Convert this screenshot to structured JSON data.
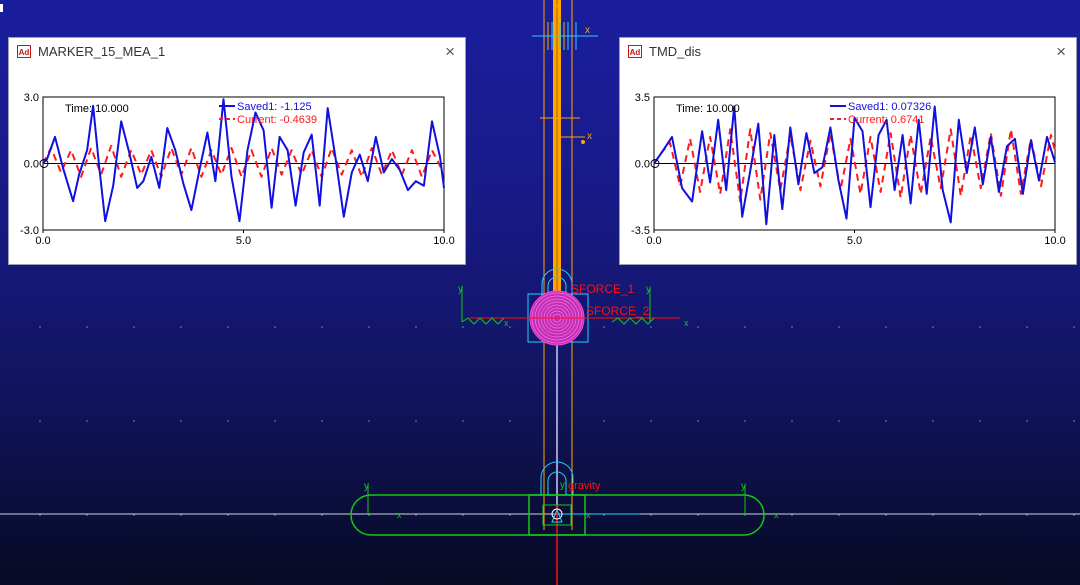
{
  "colors": {
    "saved": "#1010e0",
    "current": "#ff1a1a",
    "axis": "#000000",
    "green": "#14c814",
    "orange": "#ffa500",
    "magenta": "#e020c0",
    "red": "#ff1010",
    "cyan": "#20d0ff",
    "white": "#ffffff"
  },
  "plots": [
    {
      "title": "MARKER_15_MEA_1",
      "icon": "Ad",
      "close": "×",
      "time_label": "Time:  10.000",
      "legend": [
        {
          "label": "Saved1:  -1.125",
          "series": "saved"
        },
        {
          "label": "Current:  -0.4639",
          "series": "current"
        }
      ],
      "chart_data": {
        "type": "line",
        "xlim": [
          0,
          10
        ],
        "ylim": [
          -3,
          3
        ],
        "x_ticks": [
          "0.0",
          "5.0",
          "10.0"
        ],
        "y_ticks": [
          "3.0",
          "0.0",
          "-3.0"
        ],
        "series": [
          {
            "name": "Saved1",
            "style": "solid",
            "x": [
              0,
              0.1,
              0.3,
              0.5,
              0.75,
              0.9,
              1.1,
              1.25,
              1.4,
              1.55,
              1.75,
              1.95,
              2.15,
              2.35,
              2.5,
              2.7,
              2.9,
              3.1,
              3.3,
              3.5,
              3.7,
              3.9,
              4.1,
              4.3,
              4.5,
              4.7,
              4.9,
              5.1,
              5.3,
              5.5,
              5.7,
              5.9,
              6.1,
              6.3,
              6.5,
              6.7,
              6.9,
              7.1,
              7.3,
              7.5,
              7.7,
              7.9,
              8.1,
              8.3,
              8.5,
              8.7,
              8.9,
              9.1,
              9.3,
              9.5,
              9.7,
              9.9,
              10
            ],
            "y": [
              0,
              0.2,
              1.2,
              -0.2,
              -1.7,
              -0.5,
              0.6,
              2.6,
              -0.1,
              -2.6,
              -1,
              1.9,
              0.5,
              -1.1,
              -0.8,
              0.3,
              -1.1,
              1.6,
              0.6,
              -0.9,
              -2.1,
              -0.3,
              1.4,
              -0.8,
              2.9,
              -0.6,
              -2.6,
              0.6,
              2.3,
              1.5,
              -2.0,
              1.2,
              0.6,
              -1.9,
              0.5,
              1.3,
              -1.9,
              2.5,
              0.2,
              -2.4,
              -0.4,
              0.4,
              -0.8,
              1.2,
              -0.4,
              0.2,
              -0.3,
              -1.2,
              -0.8,
              -1.0,
              1.9,
              0.3,
              -1.1
            ]
          },
          {
            "name": "Current",
            "style": "dashed",
            "x": [
              0,
              0.2,
              0.45,
              0.7,
              0.95,
              1.2,
              1.45,
              1.7,
              1.95,
              2.2,
              2.45,
              2.7,
              2.95,
              3.2,
              3.45,
              3.7,
              3.95,
              4.2,
              4.45,
              4.7,
              4.95,
              5.2,
              5.45,
              5.7,
              5.95,
              6.2,
              6.45,
              6.7,
              6.95,
              7.2,
              7.45,
              7.7,
              7.95,
              8.2,
              8.45,
              8.7,
              8.95,
              9.2,
              9.45,
              9.7,
              10
            ],
            "y": [
              0,
              0.7,
              -0.4,
              0.6,
              -0.6,
              0.7,
              -0.5,
              0.8,
              -0.6,
              0.6,
              -0.5,
              0.6,
              -0.6,
              0.7,
              -0.5,
              0.7,
              -0.6,
              0.6,
              -0.5,
              0.7,
              -0.6,
              0.6,
              -0.6,
              0.7,
              -0.5,
              0.6,
              -0.5,
              0.6,
              -0.6,
              0.7,
              -0.5,
              0.6,
              -0.6,
              0.7,
              -0.5,
              0.6,
              -0.5,
              0.6,
              -0.6,
              0.6,
              -0.46
            ]
          }
        ]
      }
    },
    {
      "title": "TMD_dis",
      "icon": "Ad",
      "close": "×",
      "time_label": "Time:  10.000",
      "legend": [
        {
          "label": "Saved1:  0.07326",
          "series": "saved"
        },
        {
          "label": "Current:  0.6741",
          "series": "current"
        }
      ],
      "chart_data": {
        "type": "line",
        "xlim": [
          0,
          10
        ],
        "ylim": [
          -3.5,
          3.5
        ],
        "x_ticks": [
          "0.0",
          "5.0",
          "10.0"
        ],
        "y_ticks": [
          "3.5",
          "0.0",
          "-3.5"
        ],
        "series": [
          {
            "name": "Saved1",
            "style": "solid",
            "x": [
              0,
              0.2,
              0.45,
              0.7,
              0.95,
              1.2,
              1.4,
              1.6,
              1.8,
              2.0,
              2.2,
              2.4,
              2.6,
              2.8,
              3.0,
              3.2,
              3.4,
              3.6,
              3.8,
              4.0,
              4.2,
              4.4,
              4.6,
              4.8,
              5.0,
              5.2,
              5.4,
              5.6,
              5.8,
              6.0,
              6.2,
              6.4,
              6.6,
              6.8,
              7.0,
              7.2,
              7.4,
              7.6,
              7.8,
              8.0,
              8.2,
              8.4,
              8.6,
              8.8,
              9.0,
              9.2,
              9.4,
              9.6,
              9.8,
              10
            ],
            "y": [
              0,
              0.6,
              1.4,
              -1.3,
              -2.0,
              1.7,
              -1.0,
              2.3,
              -1.4,
              3.0,
              -2.8,
              -0.4,
              2.1,
              -3.2,
              1.5,
              -2.4,
              1.9,
              -1.1,
              1.6,
              -0.5,
              -0.2,
              1.9,
              -0.9,
              -2.9,
              2.4,
              1.7,
              -2.3,
              1.5,
              2.3,
              -1.4,
              1.5,
              -2.1,
              2.3,
              -1.6,
              3.0,
              -1.4,
              -3.1,
              2.3,
              -0.5,
              1.9,
              -1.1,
              1.4,
              -1.5,
              0.9,
              1.3,
              -1.6,
              1.2,
              -0.9,
              1.4,
              0.07
            ]
          },
          {
            "name": "Current",
            "style": "dashed",
            "x": [
              0,
              0.2,
              0.4,
              0.65,
              0.9,
              1.15,
              1.4,
              1.65,
              1.9,
              2.15,
              2.4,
              2.65,
              2.9,
              3.15,
              3.4,
              3.65,
              3.9,
              4.15,
              4.4,
              4.65,
              4.9,
              5.15,
              5.4,
              5.65,
              5.9,
              6.15,
              6.4,
              6.65,
              6.9,
              7.15,
              7.4,
              7.65,
              7.9,
              8.15,
              8.4,
              8.65,
              8.9,
              9.15,
              9.4,
              9.65,
              9.9,
              10
            ],
            "y": [
              0,
              0.6,
              1.1,
              -1.2,
              1.3,
              -1.5,
              1.4,
              -1.6,
              1.8,
              -2.0,
              1.8,
              -1.9,
              1.6,
              -1.4,
              1.5,
              -1.4,
              1.2,
              -1.2,
              1.6,
              -1.4,
              1.3,
              -1.6,
              1.4,
              -1.5,
              1.6,
              -1.8,
              1.5,
              -1.6,
              1.4,
              -1.3,
              1.8,
              -1.7,
              1.5,
              -1.3,
              1.6,
              -1.7,
              1.8,
              -1.6,
              1.3,
              -1.2,
              1.5,
              0.67
            ]
          }
        ]
      }
    }
  ],
  "model": {
    "labels": {
      "sforce1": "SFORCE_1",
      "sforce2": "SFORCE_2",
      "gravity": "gravity",
      "axis_x": "x",
      "axis_y": "y"
    }
  }
}
